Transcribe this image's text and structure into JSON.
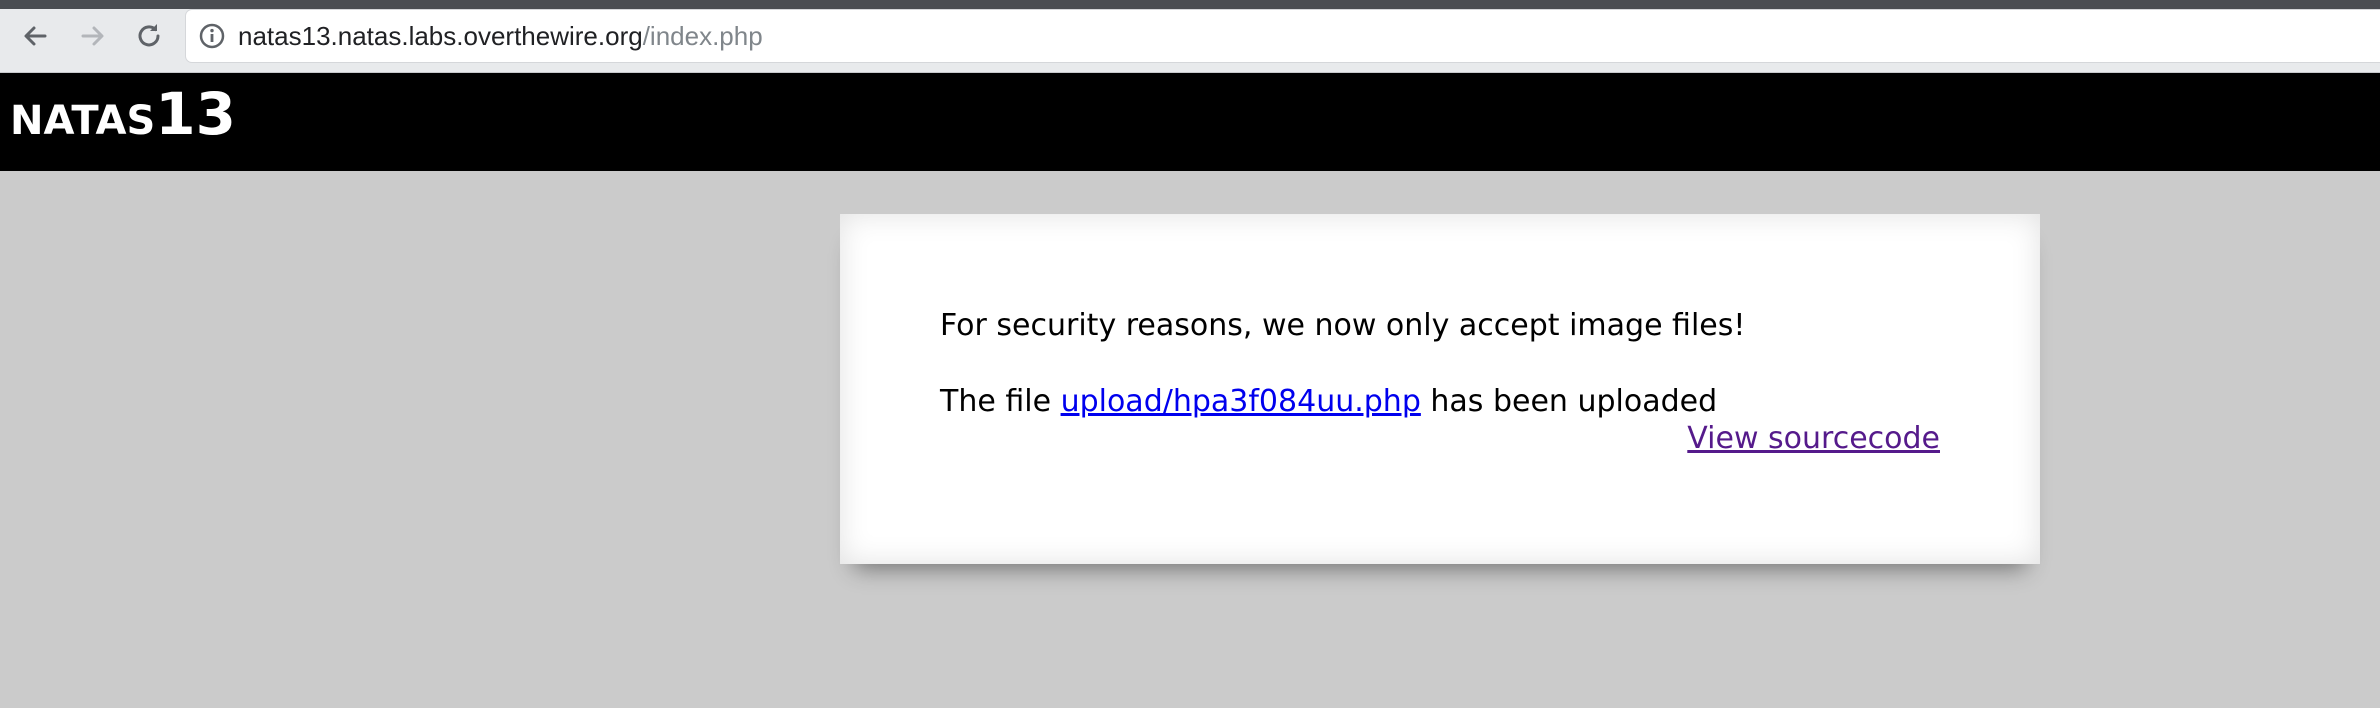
{
  "browser": {
    "url_host": "natas13.natas.labs.overthewire.org",
    "url_path": "/index.php",
    "icons": [
      "back-arrow-icon",
      "forward-arrow-icon",
      "reload-icon",
      "info-icon"
    ]
  },
  "header": {
    "title_word": "NATAS",
    "title_number": "13"
  },
  "main": {
    "security_message": "For security reasons, we now only accept image files!",
    "upload_prefix": "The file ",
    "upload_link": "upload/hpa3f084uu.php",
    "upload_suffix": " has been uploaded",
    "view_source_link": "View sourcecode"
  },
  "colors": {
    "page_background": "#cbcbcb",
    "header_background": "#000000",
    "link_unvisited": "#0000ee",
    "link_visited": "#551a8b"
  }
}
